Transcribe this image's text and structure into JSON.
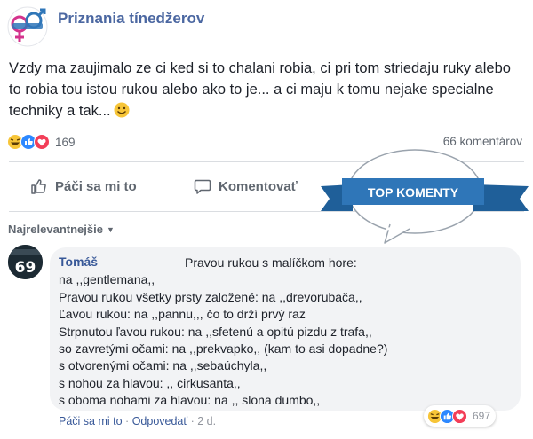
{
  "post": {
    "page_name": "Priznania tínedžerov",
    "text": "Vzdy ma zaujimalo ze ci ked si to chalani robia, ci pri tom striedaju ruky alebo to robia tou istou rukou alebo ako to je... a ci maju k tomu nejake specialne techniky a tak...",
    "reaction_count": "169",
    "comment_count": "66 komentárov",
    "reaction_icons": [
      "haha-icon",
      "like-icon",
      "love-icon"
    ]
  },
  "actions": {
    "like_label": "Páči sa mi to",
    "comment_label": "Komentovať"
  },
  "badge": {
    "label": "TOP KOMENTY"
  },
  "comments_sort": {
    "selected": "Najrelevantnejšie"
  },
  "comment": {
    "author": "Tomáš",
    "avatar_text": "69",
    "lines": [
      "Pravou rukou s malíčkom hore:",
      "na ,,gentlemana,,",
      "Pravou rukou všetky prsty založené: na ,,drevorubača,,",
      "Ľavou rukou: na ,,pannu,,, čo to drží prvý raz",
      "Strpnutou ľavou rukou: na ,,sfetenú a opitú pizdu z trafa,,",
      "so zavretými očami: na ,,prekvapko,, (kam to asi dopadne?)",
      "s otvorenými očami: na ,,sebaúchyla,,",
      "s nohou za hlavou: ,, cirkusanta,,",
      "s oboma nohami za hlavou: na ,, slona dumbo,,"
    ],
    "like_link": "Páči sa mi to",
    "reply_link": "Odpovedať",
    "separator": "·",
    "time": "2 d.",
    "reaction_count": "697",
    "reaction_icons": [
      "haha-icon",
      "like-icon",
      "love-icon"
    ]
  },
  "colors": {
    "link": "#385898",
    "page_name": "#4b67a1",
    "muted": "#606770",
    "bubble": "#f2f3f5",
    "badge_blue": "#2f76b8"
  }
}
